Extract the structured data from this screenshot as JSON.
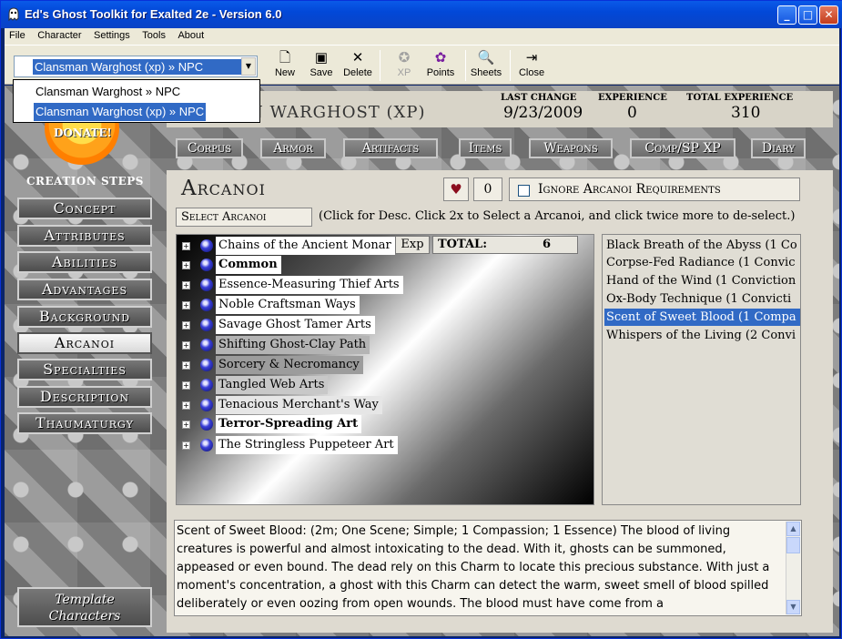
{
  "window": {
    "title": "Ed's Ghost Toolkit for Exalted 2e - Version 6.0",
    "minimize": "_",
    "maximize": "□",
    "close": "✕"
  },
  "menu": [
    "File",
    "Character",
    "Settings",
    "Tools",
    "About"
  ],
  "toolbar": {
    "new": "New",
    "save": "Save",
    "delete": "Delete",
    "xp": "XP",
    "points": "Points",
    "sheets": "Sheets",
    "close": "Close"
  },
  "character_select": {
    "selected": "Clansman Warghost (xp) » NPC",
    "options": [
      "Clansman Warghost » NPC",
      "Clansman Warghost (xp) » NPC"
    ]
  },
  "donate": "DONATE!",
  "header": {
    "character_name": "N WARGHOST (XP)",
    "last_change_label": "LAST CHANGE",
    "last_change": "9/23/2009",
    "experience_label": "EXPERIENCE",
    "experience": "0",
    "total_experience_label": "TOTAL EXPERIENCE",
    "total_experience": "310"
  },
  "tabs": [
    "Corpus",
    "Armor",
    "Artifacts",
    "Items",
    "Weapons",
    "Comp/SP XP",
    "Diary"
  ],
  "creation_steps": {
    "title": "CREATION STEPS",
    "items": [
      "Concept",
      "Attributes",
      "Abilities",
      "Advantages",
      "Background",
      "Arcanoi",
      "Specialties",
      "Description",
      "Thaumaturgy"
    ],
    "active": "Arcanoi"
  },
  "template_button": "Template Characters",
  "arcanoi": {
    "title": "Arcanoi",
    "heart_glyph": "♥",
    "essence_value": "0",
    "ignore_label": "Ignore Arcanoi Requirements",
    "select_label": "Select Arcanoi",
    "hint": "(Click for Desc.  Click 2x to Select a Arcanoi, and click twice more to de-select.)",
    "exp_label": "Exp",
    "total_label": "TOTAL:",
    "total_value": "6",
    "tree": [
      {
        "label": "Chains of the Ancient Monar",
        "bold": false
      },
      {
        "label": "Common",
        "bold": true
      },
      {
        "label": "Essence-Measuring Thief Arts",
        "bold": false
      },
      {
        "label": "Noble Craftsman Ways",
        "bold": false
      },
      {
        "label": "Savage Ghost Tamer Arts",
        "bold": false
      },
      {
        "label": "Shifting Ghost-Clay Path",
        "bold": false
      },
      {
        "label": "Sorcery & Necromancy",
        "bold": false
      },
      {
        "label": "Tangled Web Arts",
        "bold": false
      },
      {
        "label": "Tenacious Merchant's Way",
        "bold": false
      },
      {
        "label": "Terror-Spreading Art",
        "bold": true
      },
      {
        "label": "The Stringless Puppeteer Art",
        "bold": false
      }
    ],
    "charms": [
      "Black Breath of the Abyss  (1 Co",
      "Corpse-Fed Radiance  (1 Convic",
      "Hand of the Wind  (1 Conviction",
      "Ox-Body Technique  (1 Convicti",
      "Scent of Sweet Blood  (1 Compa",
      "Whispers of the Living  (2 Convi"
    ],
    "selected_charm_index": 4,
    "description": "Scent of Sweet Blood: (2m; One Scene; Simple; 1 Compassion; 1 Essence)\nThe blood of living creatures is powerful and almost intoxicating to the dead. With it, ghosts can be summoned, appeased or even bound. The dead rely on this Charm to locate this precious substance. With just a moment's concentration, a ghost with this Charm can detect the warm, sweet smell of blood spilled deliberately or even oozing from open wounds. The blood must have come from a"
  }
}
